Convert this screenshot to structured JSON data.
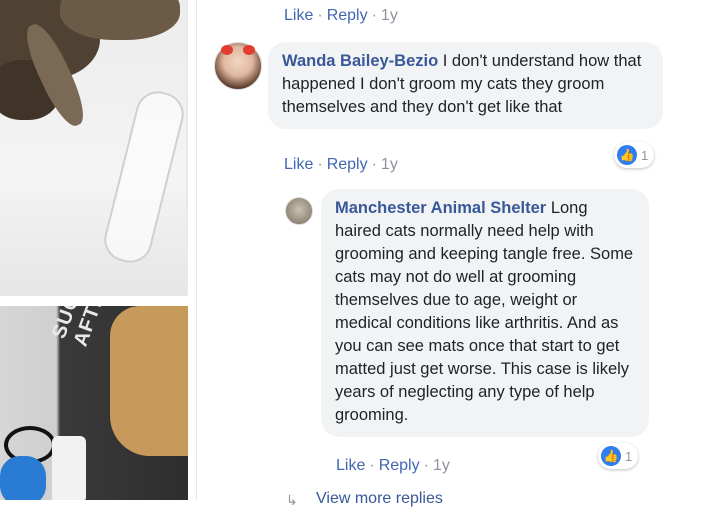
{
  "actions_top": {
    "like": "Like",
    "reply": "Reply",
    "age": "1y",
    "sep": "·"
  },
  "comment1": {
    "author": "Wanda Bailey-Bezio",
    "text": "I don't understand how that happened I don't groom my cats they groom themselves and they don't get like that",
    "reaction_count": "1",
    "actions": {
      "like": "Like",
      "reply": "Reply",
      "age": "1y",
      "sep": "·"
    }
  },
  "comment2": {
    "author": "Manchester Animal Shelter",
    "text": "Long haired cats normally need help with grooming and keeping tangle free. Some cats may not do well at grooming themselves due to age, weight or medical conditions like arthritis. And as you can see mats once that start to get matted just get worse. This case is likely years of neglecting any type of help grooming.",
    "reaction_count": "1",
    "actions": {
      "like": "Like",
      "reply": "Reply",
      "age": "1y",
      "sep": "·"
    }
  },
  "photo": {
    "shirt_text": "SUCKS AFTER"
  },
  "view_more": "View more replies",
  "colors": {
    "link": "#4267b2",
    "author": "#385898",
    "bubble": "#f2f3f5",
    "meta": "#90949c",
    "like_badge": "#2e7ef2"
  }
}
